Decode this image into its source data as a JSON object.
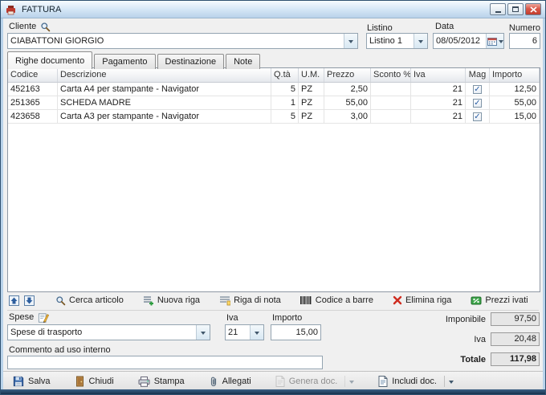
{
  "window": {
    "title": "FATTURA"
  },
  "header": {
    "cliente": {
      "label": "Cliente",
      "value": "CIABATTONI GIORGIO"
    },
    "listino": {
      "label": "Listino",
      "value": "Listino 1"
    },
    "data": {
      "label": "Data",
      "value": "08/05/2012"
    },
    "numero": {
      "label": "Numero",
      "value": "6"
    }
  },
  "tabs": [
    {
      "label": "Righe documento"
    },
    {
      "label": "Pagamento"
    },
    {
      "label": "Destinazione"
    },
    {
      "label": "Note"
    }
  ],
  "table": {
    "columns": [
      "Codice",
      "Descrizione",
      "Q.tà",
      "U.M.",
      "Prezzo",
      "Sconto %",
      "Iva",
      "Mag",
      "Importo"
    ],
    "rows": [
      {
        "codice": "452163",
        "descrizione": "Carta A4 per stampante - Navigator",
        "qta": "5",
        "um": "PZ",
        "prezzo": "2,50",
        "sconto": "",
        "iva": "21",
        "mag": "✓",
        "importo": "12,50"
      },
      {
        "codice": "251365",
        "descrizione": "SCHEDA MADRE",
        "qta": "1",
        "um": "PZ",
        "prezzo": "55,00",
        "sconto": "",
        "iva": "21",
        "mag": "✓",
        "importo": "55,00"
      },
      {
        "codice": "423658",
        "descrizione": "Carta A3 per stampante - Navigator",
        "qta": "5",
        "um": "PZ",
        "prezzo": "3,00",
        "sconto": "",
        "iva": "21",
        "mag": "✓",
        "importo": "15,00"
      }
    ]
  },
  "toolbar": {
    "cerca_articolo": "Cerca articolo",
    "nuova_riga": "Nuova riga",
    "riga_di_nota": "Riga di nota",
    "codice_a_barre": "Codice a barre",
    "elimina_riga": "Elimina riga",
    "prezzi_ivati": "Prezzi ivati"
  },
  "spese": {
    "label": "Spese",
    "value": "Spese di trasporto",
    "iva_label": "Iva",
    "iva_value": "21",
    "importo_label": "Importo",
    "importo_value": "15,00"
  },
  "totals": {
    "imponibile_label": "Imponibile",
    "imponibile_value": "97,50",
    "iva_label": "Iva",
    "iva_value": "20,48",
    "totale_label": "Totale",
    "totale_value": "117,98"
  },
  "commento": {
    "label": "Commento ad uso interno",
    "value": ""
  },
  "actions": {
    "salva": "Salva",
    "chiudi": "Chiudi",
    "stampa": "Stampa",
    "allegati": "Allegati",
    "genera_doc": "Genera doc.",
    "includi_doc": "Includi doc."
  }
}
